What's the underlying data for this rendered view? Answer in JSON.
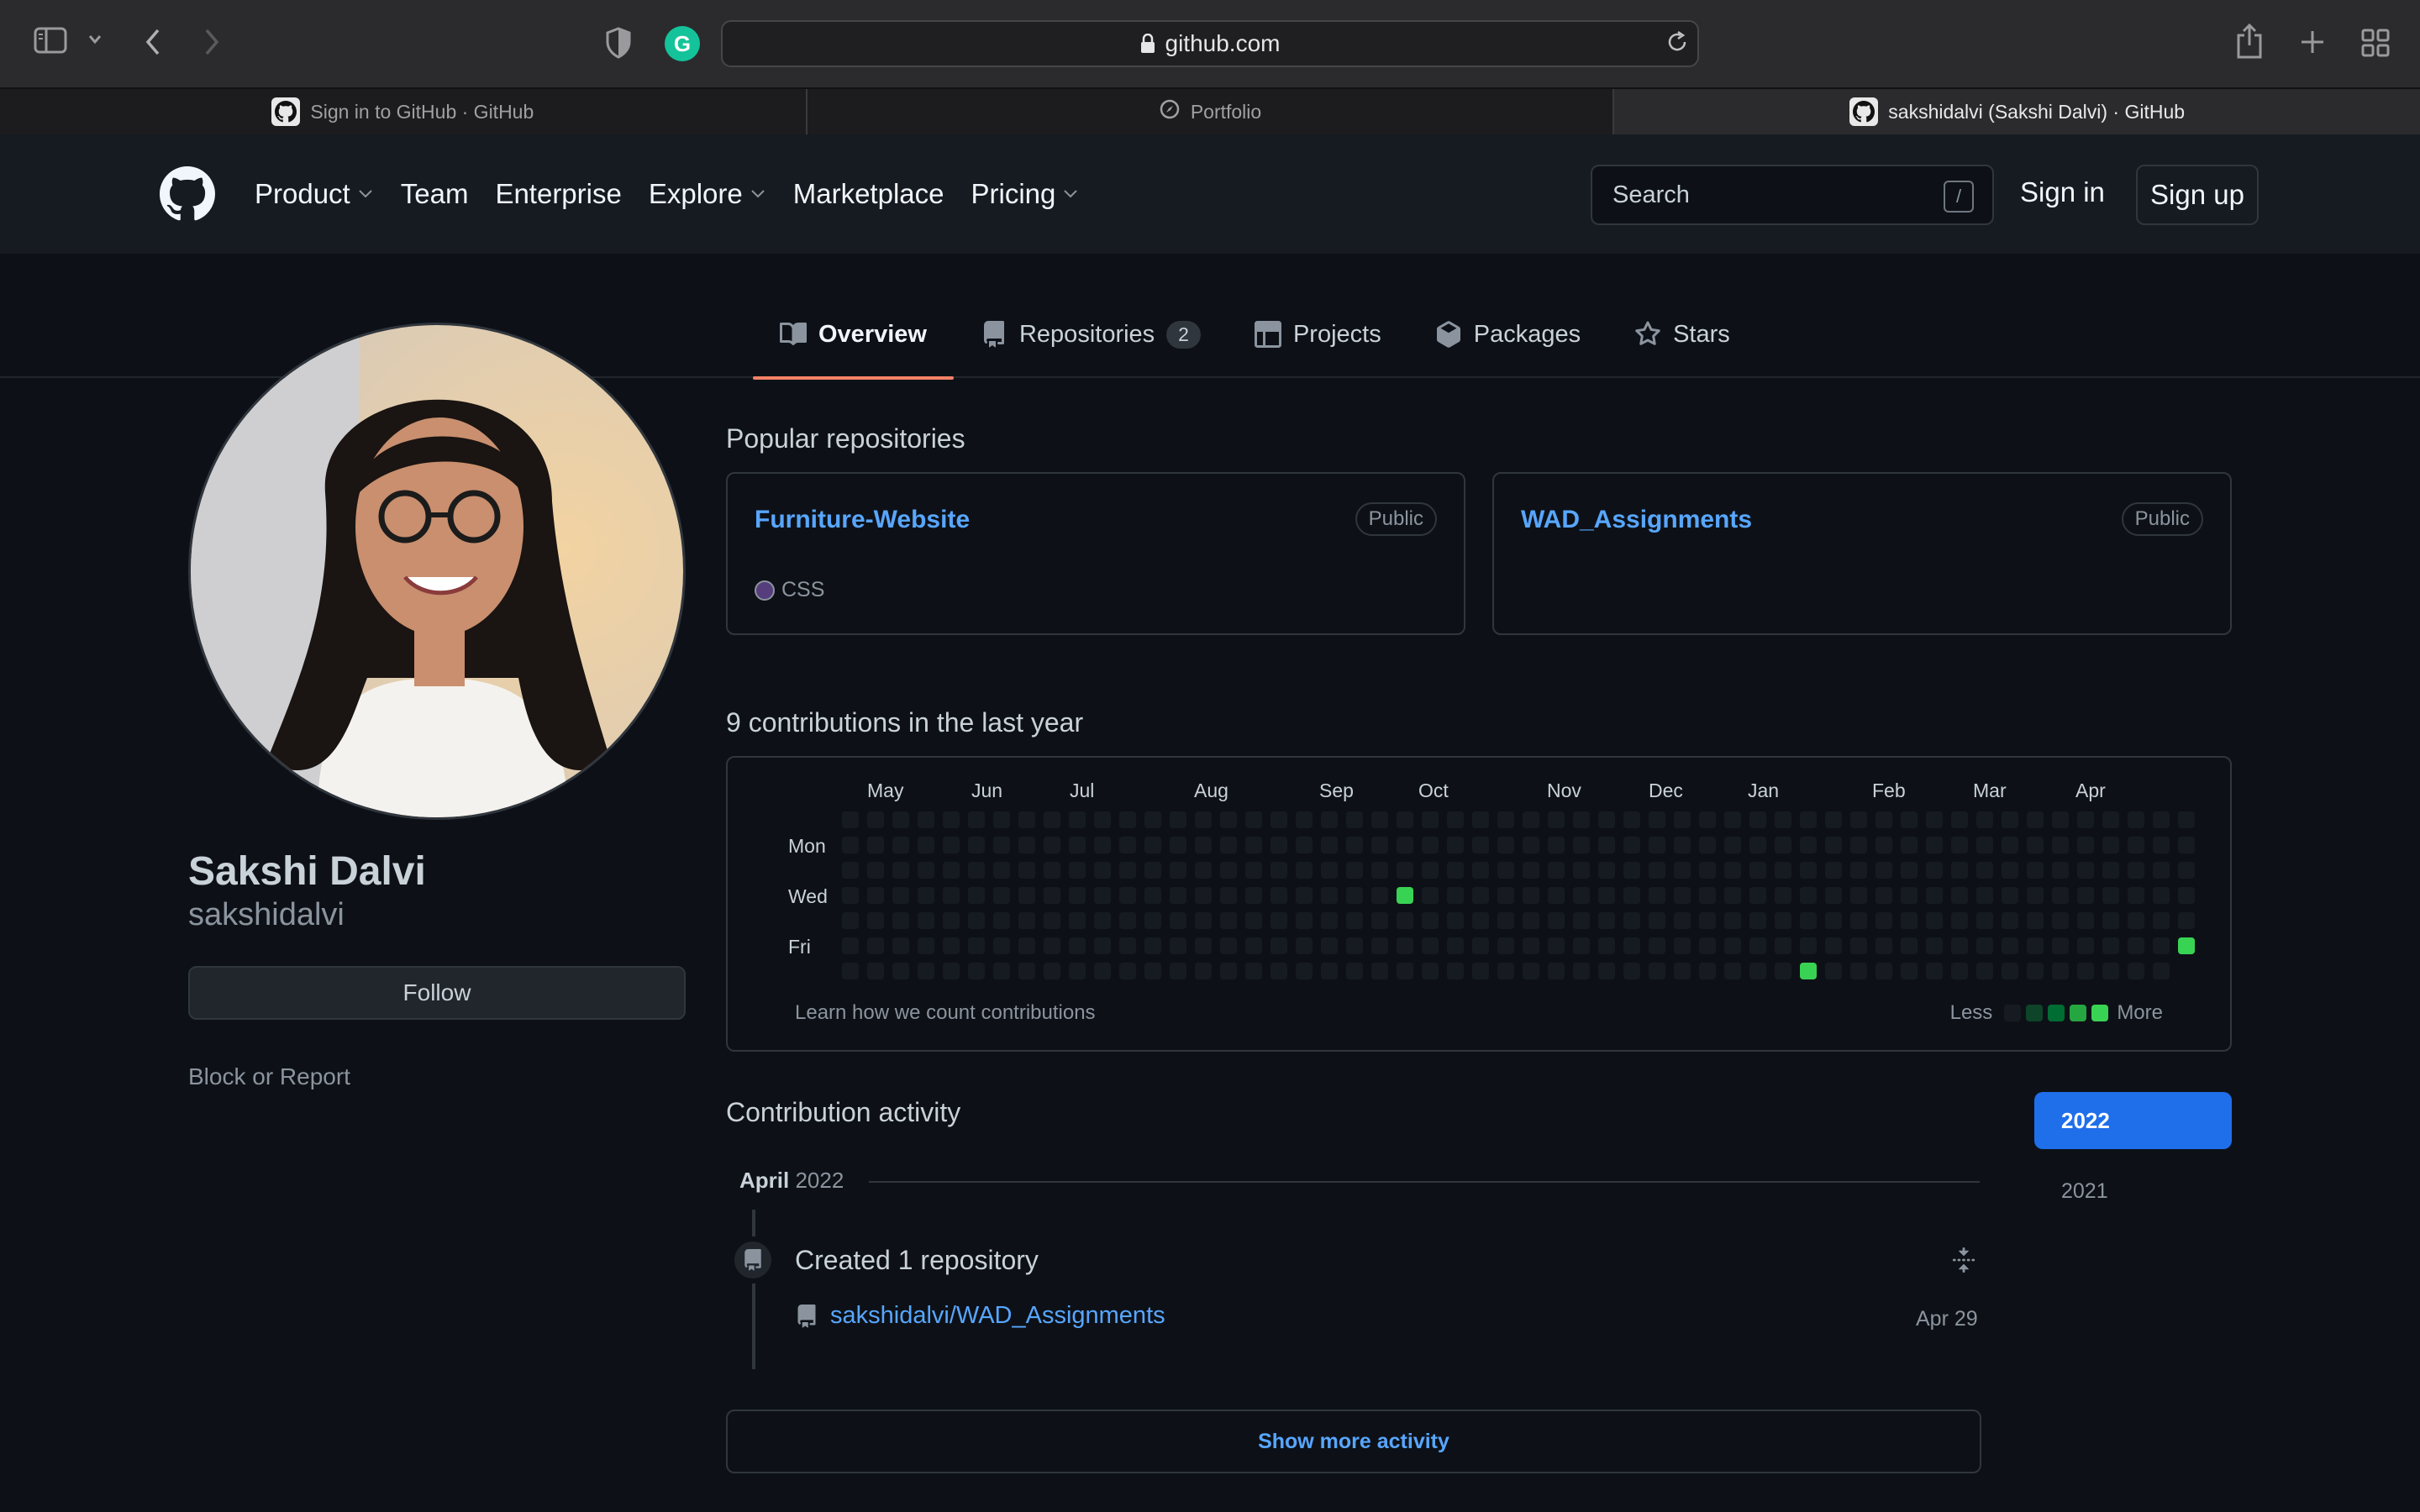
{
  "browser": {
    "url": "github.com",
    "tabs": [
      {
        "label": "Sign in to GitHub · GitHub"
      },
      {
        "label": "Portfolio"
      },
      {
        "label": "sakshidalvi (Sakshi Dalvi) · GitHub"
      }
    ],
    "grammarly_letter": "G"
  },
  "header": {
    "nav": [
      {
        "label": "Product",
        "dropdown": true
      },
      {
        "label": "Team",
        "dropdown": false
      },
      {
        "label": "Enterprise",
        "dropdown": false
      },
      {
        "label": "Explore",
        "dropdown": true
      },
      {
        "label": "Marketplace",
        "dropdown": false
      },
      {
        "label": "Pricing",
        "dropdown": true
      }
    ],
    "search_placeholder": "Search",
    "search_shortcut": "/",
    "sign_in": "Sign in",
    "sign_up": "Sign up"
  },
  "profile_tabs": [
    {
      "label": "Overview",
      "active": true,
      "icon": "book-icon"
    },
    {
      "label": "Repositories",
      "count": "2",
      "icon": "repo-icon"
    },
    {
      "label": "Projects",
      "icon": "table-icon"
    },
    {
      "label": "Packages",
      "icon": "package-icon"
    },
    {
      "label": "Stars",
      "icon": "star-icon"
    }
  ],
  "profile": {
    "full_name": "Sakshi Dalvi",
    "username": "sakshidalvi",
    "follow_label": "Follow",
    "block_label": "Block or Report"
  },
  "popular": {
    "title": "Popular repositories",
    "repos": [
      {
        "name": "Furniture-Website",
        "visibility": "Public",
        "language": "CSS",
        "language_color": "#563d7c"
      },
      {
        "name": "WAD_Assignments",
        "visibility": "Public",
        "language": "",
        "language_color": ""
      }
    ]
  },
  "contributions": {
    "title": "9 contributions in the last year",
    "months": [
      "May",
      "Jun",
      "Jul",
      "Aug",
      "Sep",
      "Oct",
      "Nov",
      "Dec",
      "Jan",
      "Feb",
      "Mar",
      "Apr"
    ],
    "days": [
      "Mon",
      "Wed",
      "Fri"
    ],
    "learn_label": "Learn how we count contributions",
    "less_label": "Less",
    "more_label": "More",
    "level_colors": [
      "#161b22",
      "#0e4429",
      "#006d32",
      "#26a641",
      "#39d353"
    ],
    "active_cells": [
      {
        "week": 22,
        "day": 3,
        "level": 4
      },
      {
        "week": 38,
        "day": 6,
        "level": 4
      },
      {
        "week": 53,
        "day": 5,
        "level": 4
      }
    ]
  },
  "activity": {
    "title": "Contribution activity",
    "years": [
      "2022",
      "2021"
    ],
    "month_label": "April",
    "month_year": "2022",
    "event_title": "Created 1 repository",
    "event_repo": "sakshidalvi/WAD_Assignments",
    "event_date": "Apr 29",
    "show_more": "Show more activity"
  }
}
